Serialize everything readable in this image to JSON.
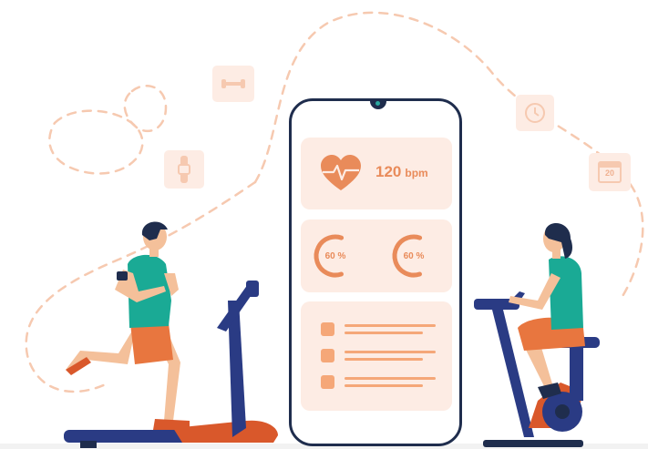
{
  "heart_rate": {
    "value": "120",
    "unit": "bpm"
  },
  "gauges": [
    {
      "label": "60 %",
      "level": 0.6
    },
    {
      "label": "60 %",
      "level": 0.6
    }
  ],
  "calendar_day": "20",
  "checklist_items": 3,
  "colors": {
    "accent": "#e98b5a",
    "card_bg": "#fdece4",
    "navy": "#1f2d4d",
    "teal": "#1aaa95",
    "orange": "#e8763f"
  },
  "icons": [
    "dumbbell-icon",
    "clock-icon",
    "calendar-icon",
    "fitness-band-icon",
    "heart-pulse-icon"
  ]
}
